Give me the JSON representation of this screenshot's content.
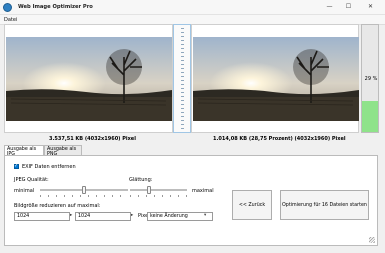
{
  "window": {
    "title": "Web Image Optimizer Pro",
    "controls": {
      "minimize": "—",
      "maximize": "☐",
      "close": "✕"
    }
  },
  "menu": {
    "items": [
      "Datei"
    ]
  },
  "preview": {
    "original_size_label": "3.537,51 KB (4032x1960) Pixel",
    "optimized_size_label": "1.014,08 KB (28,75 Prozent) (4032x1960) Pixel",
    "ratio_label": "29 %",
    "ratio_fraction": 0.29,
    "ratio_color": "#8fe38a"
  },
  "tabs": [
    {
      "label": "Ausgabe als JPG",
      "active": true
    },
    {
      "label": "Ausgabe als PNG",
      "active": false
    }
  ],
  "options": {
    "exif_label": "EXIF Daten entfernen",
    "exif_checked": true,
    "quality_label": "JPEG Qualität:",
    "smoothing_label": "Glättung:",
    "min_label": "minimal",
    "max_label": "maximal",
    "quality_value": 0.5,
    "smoothing_value": 0.32,
    "resize_label": "Bildgröße reduzieren auf maximal:",
    "width_value": "1024",
    "height_value": "1024",
    "unit_label": "Pixel",
    "resize_mode_value": "keine Änderung",
    "accent_color": "#0078d7"
  },
  "buttons": {
    "back": "<< Zurück",
    "start": "Optimierung für 16 Dateien starten"
  },
  "icons": {
    "spinner_arrow": "▸",
    "dropdown_arrow": "▾"
  }
}
